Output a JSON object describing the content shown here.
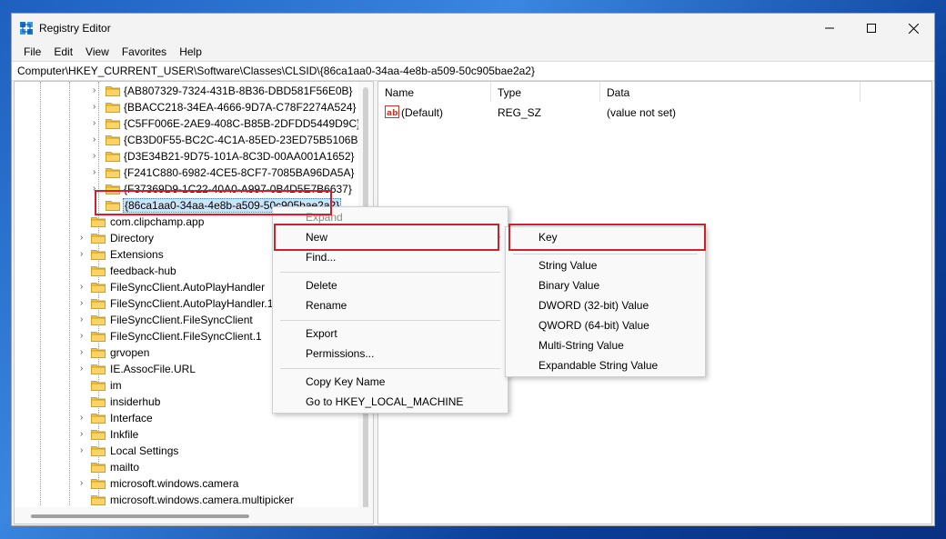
{
  "window": {
    "title": "Registry Editor",
    "controls": {
      "minimize": "minimize-icon",
      "maximize": "maximize-icon",
      "close": "close-icon"
    }
  },
  "menubar": [
    "File",
    "Edit",
    "View",
    "Favorites",
    "Help"
  ],
  "address": "Computer\\HKEY_CURRENT_USER\\Software\\Classes\\CLSID\\{86ca1aa0-34aa-4e8b-a509-50c905bae2a2}",
  "tree": {
    "guids": [
      "{AB807329-7324-431B-8B36-DBD581F56E0B}",
      "{BBACC218-34EA-4666-9D7A-C78F2274A524}",
      "{C5FF006E-2AE9-408C-B85B-2DFDD5449D9C}",
      "{CB3D0F55-BC2C-4C1A-85ED-23ED75B5106B}",
      "{D3E34B21-9D75-101A-8C3D-00AA001A1652}",
      "{F241C880-6982-4CE5-8CF7-7085BA96DA5A}",
      "{F37369D9-1C22-40A0-A997-0B4D5E7B6637}"
    ],
    "selected": "{86ca1aa0-34aa-4e8b-a509-50c905bae2a2}",
    "items": [
      "com.clipchamp.app",
      "Directory",
      "Extensions",
      "feedback-hub",
      "FileSyncClient.AutoPlayHandler",
      "FileSyncClient.AutoPlayHandler.1",
      "FileSyncClient.FileSyncClient",
      "FileSyncClient.FileSyncClient.1",
      "grvopen",
      "IE.AssocFile.URL",
      "im",
      "insiderhub",
      "Interface",
      "Inkfile",
      "Local Settings",
      "mailto",
      "microsoft.windows.camera",
      "microsoft.windows.camera.multipicker"
    ],
    "expandable": [
      false,
      true,
      true,
      false,
      true,
      true,
      true,
      true,
      true,
      true,
      false,
      false,
      true,
      true,
      true,
      false,
      true,
      false
    ]
  },
  "list": {
    "columns": [
      "Name",
      "Type",
      "Data"
    ],
    "rows": [
      {
        "icon": "ab-string-icon",
        "name": "(Default)",
        "type": "REG_SZ",
        "data": "(value not set)"
      }
    ]
  },
  "context_menu": {
    "expand": "Expand",
    "new": "New",
    "find": "Find...",
    "delete": "Delete",
    "rename": "Rename",
    "export": "Export",
    "permissions": "Permissions...",
    "copy_key_name": "Copy Key Name",
    "goto": "Go to HKEY_LOCAL_MACHINE"
  },
  "submenu": {
    "key": "Key",
    "string": "String Value",
    "binary": "Binary Value",
    "dword": "DWORD (32-bit) Value",
    "qword": "QWORD (64-bit) Value",
    "multi": "Multi-String Value",
    "expandable": "Expandable String Value"
  },
  "colors": {
    "highlight": "#d0202a",
    "selection": "#cce4f7",
    "folder": "#f5c542"
  }
}
